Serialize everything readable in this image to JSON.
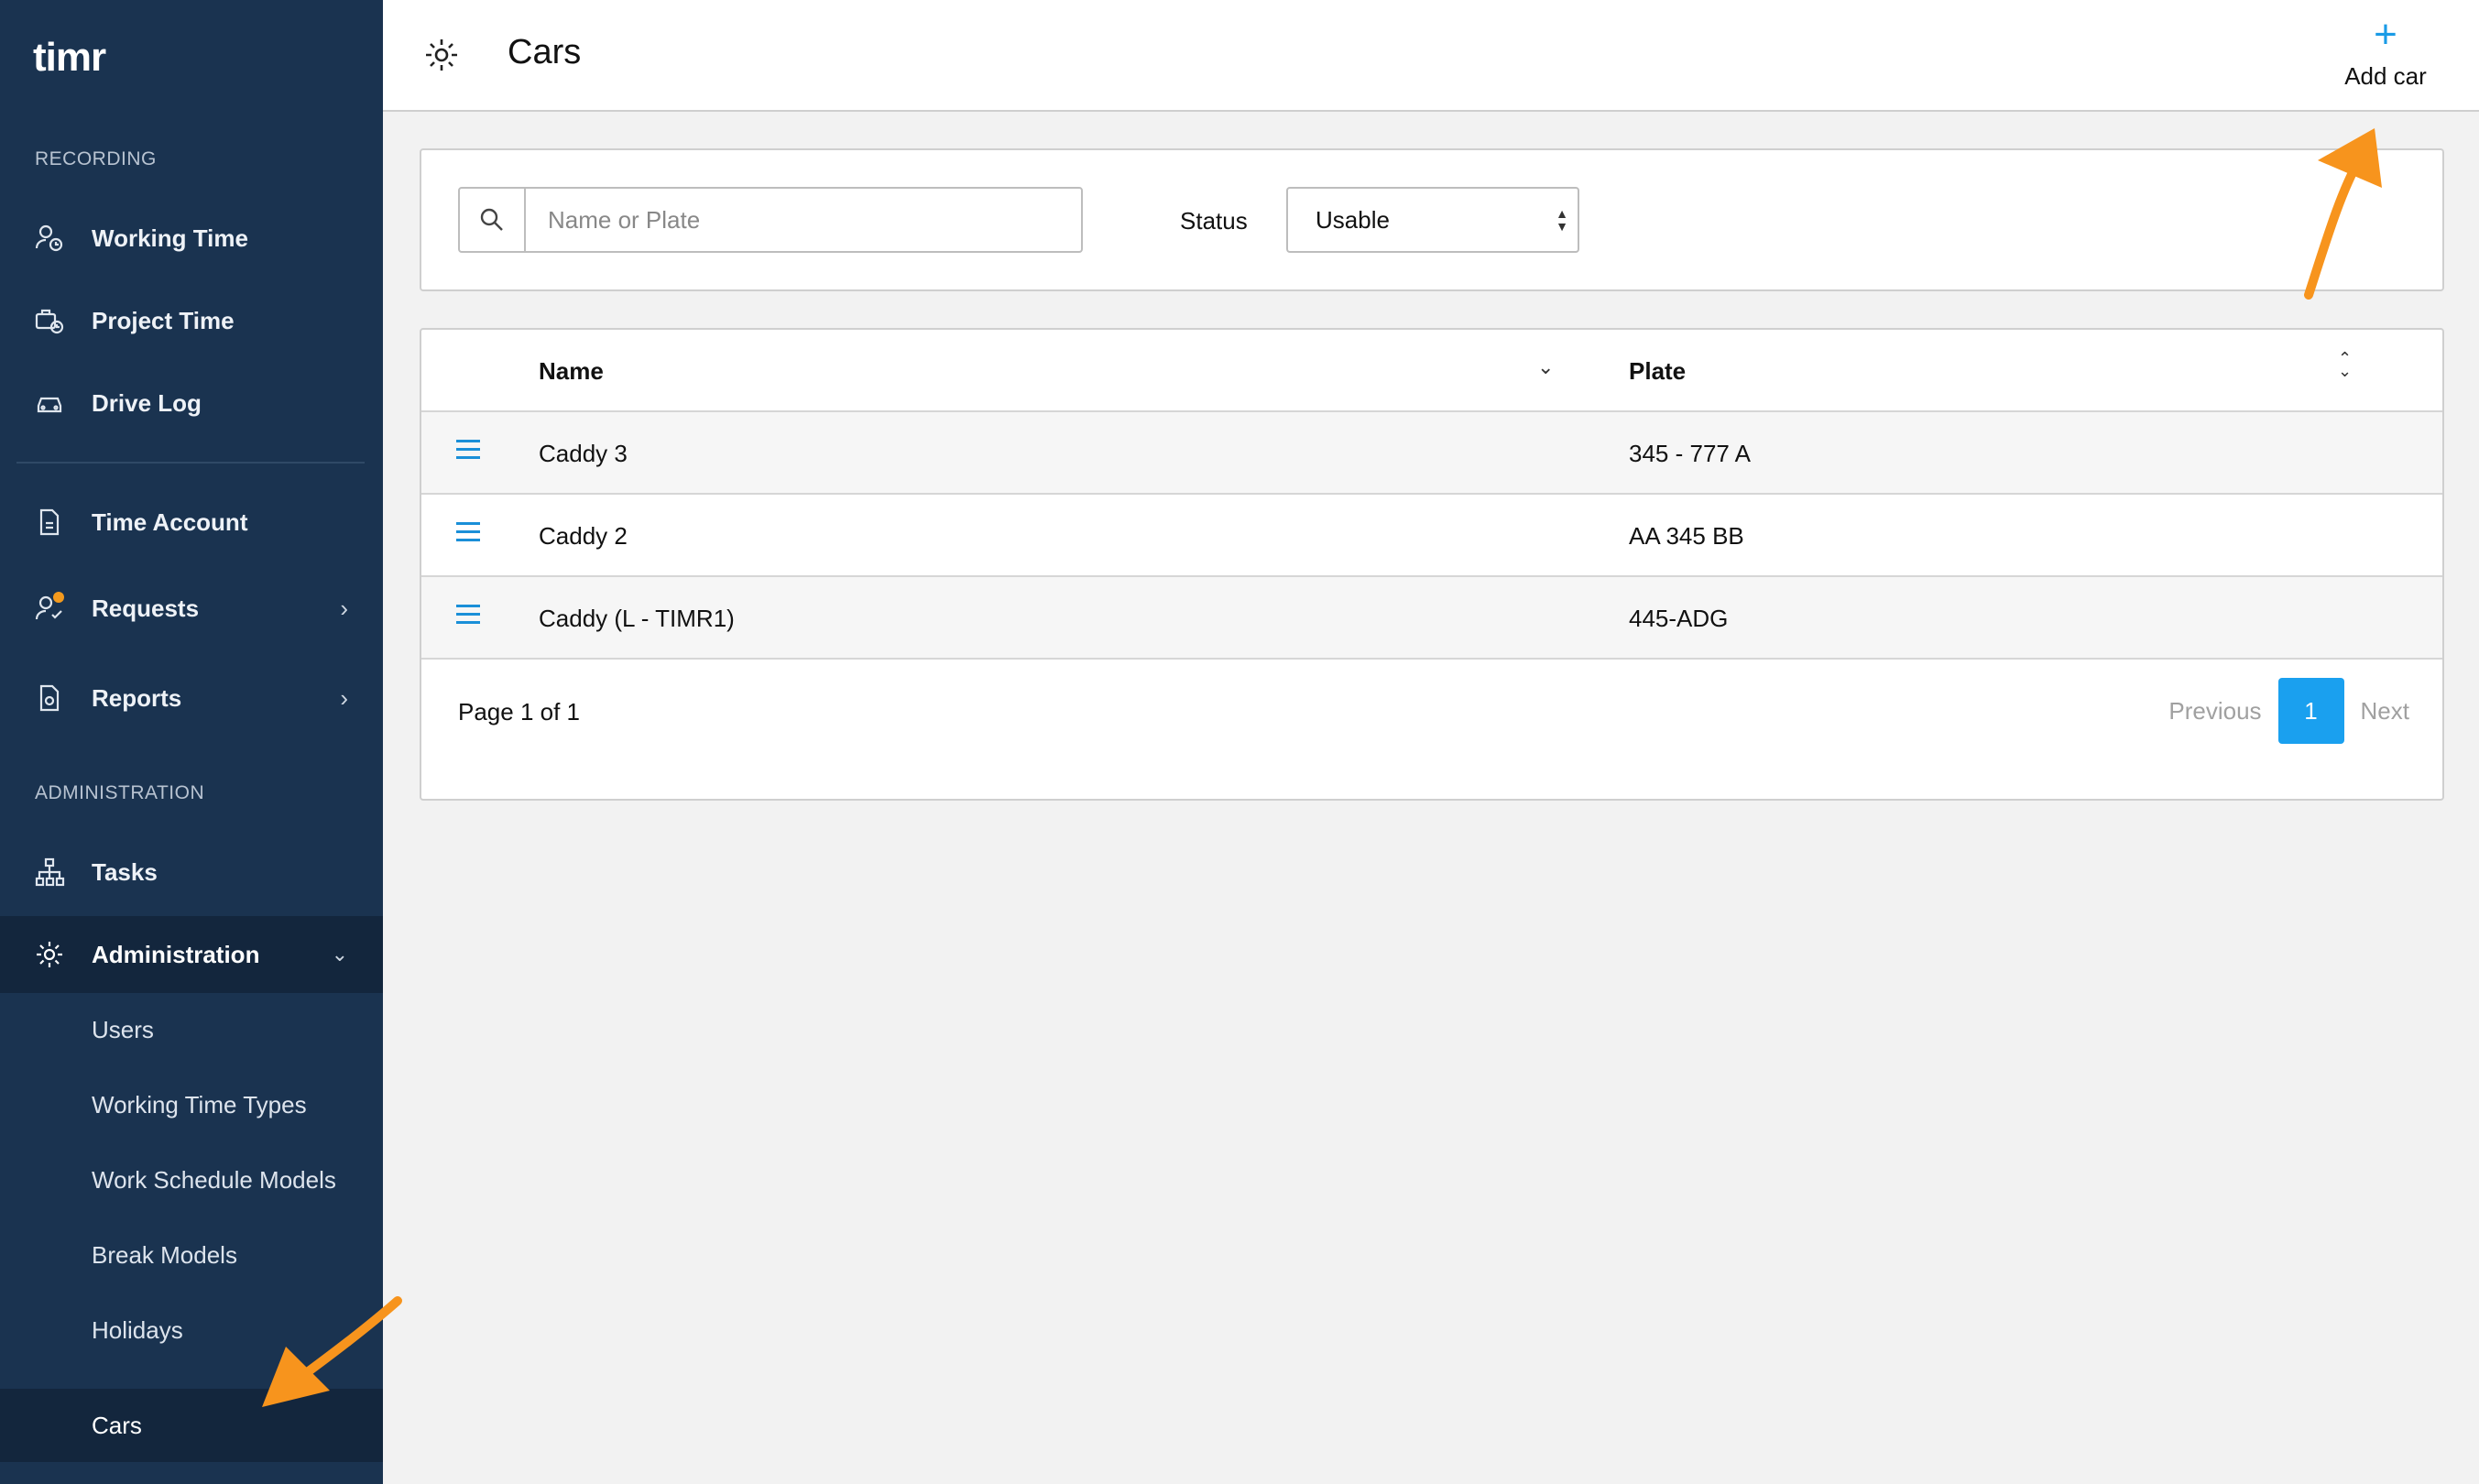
{
  "app": {
    "logo_text": "timr"
  },
  "sidebar": {
    "section_recording": "RECORDING",
    "section_administration": "ADMINISTRATION",
    "items": [
      {
        "label": "Working Time"
      },
      {
        "label": "Project Time"
      },
      {
        "label": "Drive Log"
      },
      {
        "label": "Time Account"
      },
      {
        "label": "Requests"
      },
      {
        "label": "Reports"
      },
      {
        "label": "Tasks"
      },
      {
        "label": "Administration"
      }
    ],
    "submenu": [
      {
        "label": "Users"
      },
      {
        "label": "Working Time Types"
      },
      {
        "label": "Work Schedule Models"
      },
      {
        "label": "Break Models"
      },
      {
        "label": "Holidays"
      },
      {
        "label": "Cars"
      }
    ],
    "colors": {
      "background": "#1a3350",
      "active": "#13263d",
      "badge": "#f39a1e"
    }
  },
  "header": {
    "title": "Cars",
    "add_label": "Add car",
    "add_icon": "plus-icon"
  },
  "filter": {
    "search_placeholder": "Name or Plate",
    "search_value": "",
    "status_label": "Status",
    "status_value": "Usable"
  },
  "table": {
    "columns": [
      "Name",
      "Plate"
    ],
    "rows": [
      {
        "name": "Caddy 3",
        "plate": "345 - 777 A"
      },
      {
        "name": "Caddy 2",
        "plate": "AA 345 BB"
      },
      {
        "name": "Caddy (L - TIMR1)",
        "plate": "445-ADG"
      }
    ]
  },
  "pagination": {
    "summary": "Page 1 of 1",
    "previous": "Previous",
    "current": "1",
    "next": "Next",
    "accent": "#1aa0ef"
  },
  "annotation_color": "#f7941d"
}
